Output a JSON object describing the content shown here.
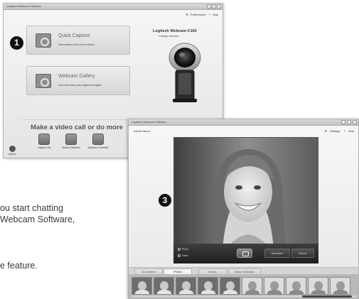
{
  "main_window": {
    "title": "Logitech Webcam Software",
    "links": {
      "preferences": "Preferences",
      "help": "Help"
    },
    "callout_number": "1",
    "quick_capture": {
      "label": "Quick Capture",
      "description": "Take pictures and record videos."
    },
    "webcam_gallery": {
      "label": "Webcam Gallery",
      "description": "View and share your captured images."
    },
    "camera": {
      "name": "Logitech Webcam C160",
      "change_link": "Change webcam"
    },
    "section_heading": "Make a video call or do more",
    "apps": [
      {
        "label": "Logitech Vid",
        "icon": "vid-icon"
      },
      {
        "label": "Motion Detection",
        "icon": "motion-detection-icon"
      },
      {
        "label": "Webcam Controller",
        "icon": "webcam-controller-icon"
      }
    ],
    "logo_text": "Logitech"
  },
  "capture_window": {
    "title": "Logitech Webcam Software",
    "back_link": "Main Menu",
    "links": {
      "settings": "Settings",
      "help": "Help"
    },
    "callout_number": "3",
    "mode_options": {
      "photo": "Photo",
      "video": "Video"
    },
    "buttons": {
      "quickstart": "Quickstart",
      "effects": "Effects"
    },
    "tabs": [
      "All Content",
      "Photos",
      "Videos",
      "Motion Detection"
    ],
    "active_tab": "Photos"
  },
  "instructions": {
    "line1": "ou start chatting",
    "line2": "Webcam Software,",
    "line3": "e feature."
  }
}
